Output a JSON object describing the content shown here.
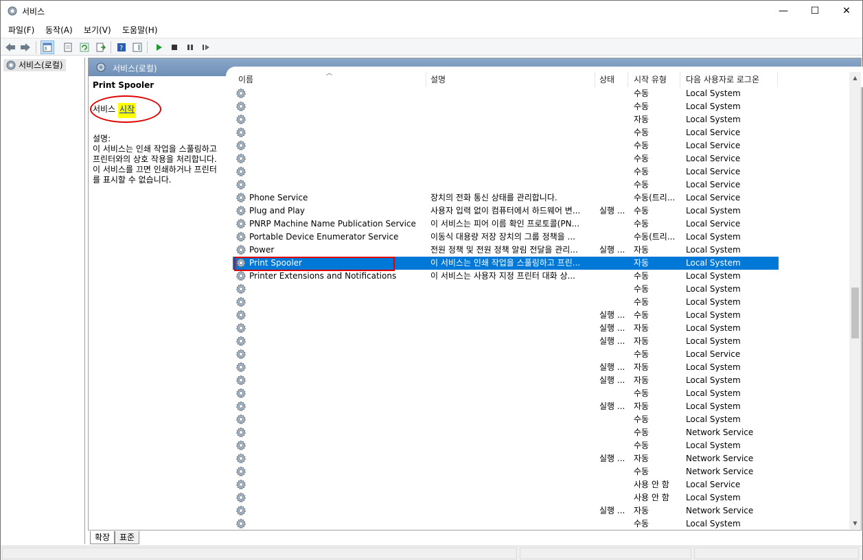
{
  "window": {
    "title": "서비스"
  },
  "menu": [
    "파일(F)",
    "동작(A)",
    "보기(V)",
    "도움말(H)"
  ],
  "tree": {
    "root": "서비스(로컬)"
  },
  "pane": {
    "title": "서비스(로컬)"
  },
  "detail": {
    "service_name": "Print Spooler",
    "start_prefix": "서비스 ",
    "start_link": "시작",
    "description": "설명:\n이 서비스는 인쇄 작업을 스풀링하고\n프린터와의 상호 작용을 처리합니다.\n이 서비스를 끄면 인쇄하거나 프린터\n를 표시할 수 없습니다."
  },
  "columns": [
    "이름",
    "설명",
    "상태",
    "시작 유형",
    "다음 사용자로 로그온"
  ],
  "rows": [
    {
      "name": "",
      "desc": "",
      "status": "",
      "stype": "수동",
      "logon": "Local System"
    },
    {
      "name": "",
      "desc": "",
      "status": "",
      "stype": "수동",
      "logon": "Local System"
    },
    {
      "name": "",
      "desc": "",
      "status": "",
      "stype": "자동",
      "logon": "Local System"
    },
    {
      "name": "",
      "desc": "",
      "status": "",
      "stype": "수동",
      "logon": "Local Service"
    },
    {
      "name": "",
      "desc": "",
      "status": "",
      "stype": "수동",
      "logon": "Local Service"
    },
    {
      "name": "",
      "desc": "",
      "status": "",
      "stype": "수동",
      "logon": "Local Service"
    },
    {
      "name": "",
      "desc": "",
      "status": "",
      "stype": "수동",
      "logon": "Local Service"
    },
    {
      "name": "",
      "desc": "",
      "status": "",
      "stype": "수동",
      "logon": "Local Service"
    },
    {
      "name": "Phone Service",
      "desc": "장치의 전화 통신 상태를 관리합니다.",
      "status": "",
      "stype": "수동(트리...",
      "logon": "Local Service"
    },
    {
      "name": "Plug and Play",
      "desc": "사용자 입력 없이 컴퓨터에서 하드웨어 변...",
      "status": "실행 ...",
      "stype": "수동",
      "logon": "Local System"
    },
    {
      "name": "PNRP Machine Name Publication Service",
      "desc": "이 서비스는 피어 이름 확인 프로토콜(PN...",
      "status": "",
      "stype": "수동",
      "logon": "Local Service"
    },
    {
      "name": "Portable Device Enumerator Service",
      "desc": "이동식 대용량 저장 장치의 그룹 정책을 ...",
      "status": "",
      "stype": "수동(트리...",
      "logon": "Local System"
    },
    {
      "name": "Power",
      "desc": "전원 정책 및 전원 정책 알림 전달을 관리...",
      "status": "실행 ...",
      "stype": "자동",
      "logon": "Local System"
    },
    {
      "name": "Print Spooler",
      "desc": "이 서비스는 인쇄 작업을 스풀링하고 프린...",
      "status": "",
      "stype": "자동",
      "logon": "Local System",
      "selected": true
    },
    {
      "name": "Printer Extensions and Notifications",
      "desc": "이 서비스는 사용자 지정 프린터 대화 상...",
      "status": "",
      "stype": "수동",
      "logon": "Local System"
    },
    {
      "name": "",
      "desc": "",
      "status": "",
      "stype": "수동",
      "logon": "Local System"
    },
    {
      "name": "",
      "desc": "",
      "status": "",
      "stype": "수동",
      "logon": "Local System"
    },
    {
      "name": "",
      "desc": "",
      "status": "실행 ...",
      "stype": "수동",
      "logon": "Local System"
    },
    {
      "name": "",
      "desc": "",
      "status": "실행 ...",
      "stype": "자동",
      "logon": "Local System"
    },
    {
      "name": "",
      "desc": "",
      "status": "실행 ...",
      "stype": "자동",
      "logon": "Local System"
    },
    {
      "name": "",
      "desc": "",
      "status": "",
      "stype": "수동",
      "logon": "Local Service"
    },
    {
      "name": "",
      "desc": "",
      "status": "실행 ...",
      "stype": "자동",
      "logon": "Local System"
    },
    {
      "name": "",
      "desc": "",
      "status": "실행 ...",
      "stype": "자동",
      "logon": "Local System"
    },
    {
      "name": "",
      "desc": "",
      "status": "",
      "stype": "수동",
      "logon": "Local System"
    },
    {
      "name": "",
      "desc": "",
      "status": "실행 ...",
      "stype": "자동",
      "logon": "Local System"
    },
    {
      "name": "",
      "desc": "",
      "status": "",
      "stype": "수동",
      "logon": "Local System"
    },
    {
      "name": "",
      "desc": "",
      "status": "",
      "stype": "수동",
      "logon": "Network Service"
    },
    {
      "name": "",
      "desc": "",
      "status": "",
      "stype": "수동",
      "logon": "Local System"
    },
    {
      "name": "",
      "desc": "",
      "status": "실행 ...",
      "stype": "자동",
      "logon": "Network Service"
    },
    {
      "name": "",
      "desc": "",
      "status": "",
      "stype": "수동",
      "logon": "Network Service"
    },
    {
      "name": "",
      "desc": "",
      "status": "",
      "stype": "사용 안 함",
      "logon": "Local Service"
    },
    {
      "name": "",
      "desc": "",
      "status": "",
      "stype": "사용 안 함",
      "logon": "Local System"
    },
    {
      "name": "",
      "desc": "",
      "status": "실행 ...",
      "stype": "자동",
      "logon": "Network Service"
    },
    {
      "name": "",
      "desc": "",
      "status": "",
      "stype": "수동",
      "logon": "Local System"
    }
  ],
  "tabs": [
    "확장",
    "표준"
  ],
  "colors": {
    "selection": "#0078d7",
    "highlight": "#ffff00",
    "annotation": "#e00000",
    "pane_header": "#7b99bd"
  }
}
